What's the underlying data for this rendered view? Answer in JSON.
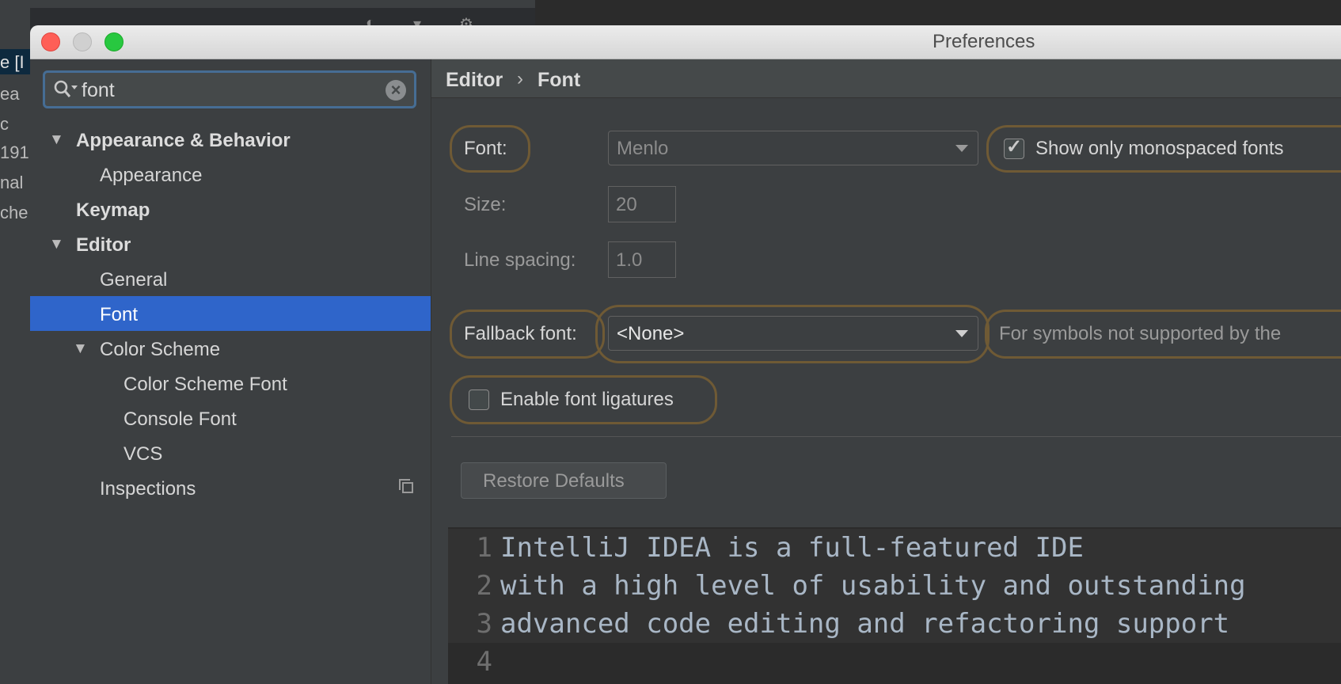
{
  "window": {
    "title": "Preferences"
  },
  "search": {
    "value": "font"
  },
  "background": {
    "left_fragments": [
      "e [I",
      "ea",
      "c",
      "191",
      "nal",
      "che"
    ]
  },
  "tree": [
    {
      "label": "Appearance & Behavior",
      "bold": true,
      "expanded": true
    },
    {
      "label": "Appearance"
    },
    {
      "label": "Keymap",
      "bold": true
    },
    {
      "label": "Editor",
      "bold": true,
      "expanded": true
    },
    {
      "label": "General"
    },
    {
      "label": "Font",
      "selected": true
    },
    {
      "label": "Color Scheme",
      "expanded": true
    },
    {
      "label": "Color Scheme Font"
    },
    {
      "label": "Console Font"
    },
    {
      "label": "VCS"
    },
    {
      "label": "Inspections"
    }
  ],
  "breadcrumb": {
    "parent": "Editor",
    "current": "Font",
    "separator": "›"
  },
  "font": {
    "label": "Font:",
    "value": "Menlo",
    "monospaced_label": "Show only monospaced fonts",
    "monospaced_checked": true
  },
  "size": {
    "label": "Size:",
    "value": "20"
  },
  "line_spacing": {
    "label": "Line spacing:",
    "value": "1.0"
  },
  "fallback": {
    "label": "Fallback font:",
    "value": "<None>",
    "hint": "For symbols not supported by the"
  },
  "ligatures": {
    "label": "Enable font ligatures",
    "checked": false
  },
  "restore_label": "Restore Defaults",
  "preview": {
    "lines": [
      {
        "num": "1",
        "text": "IntelliJ IDEA is a full-featured IDE"
      },
      {
        "num": "2",
        "text": "with a high level of usability and outstanding"
      },
      {
        "num": "3",
        "text": "advanced code editing and refactoring support"
      },
      {
        "num": "4",
        "text": ""
      }
    ]
  },
  "colors": {
    "selection": "#2f65ca",
    "highlight_outline": "#6f5a35",
    "panel": "#3c3f41",
    "editor_bg": "#2b2b2b"
  }
}
